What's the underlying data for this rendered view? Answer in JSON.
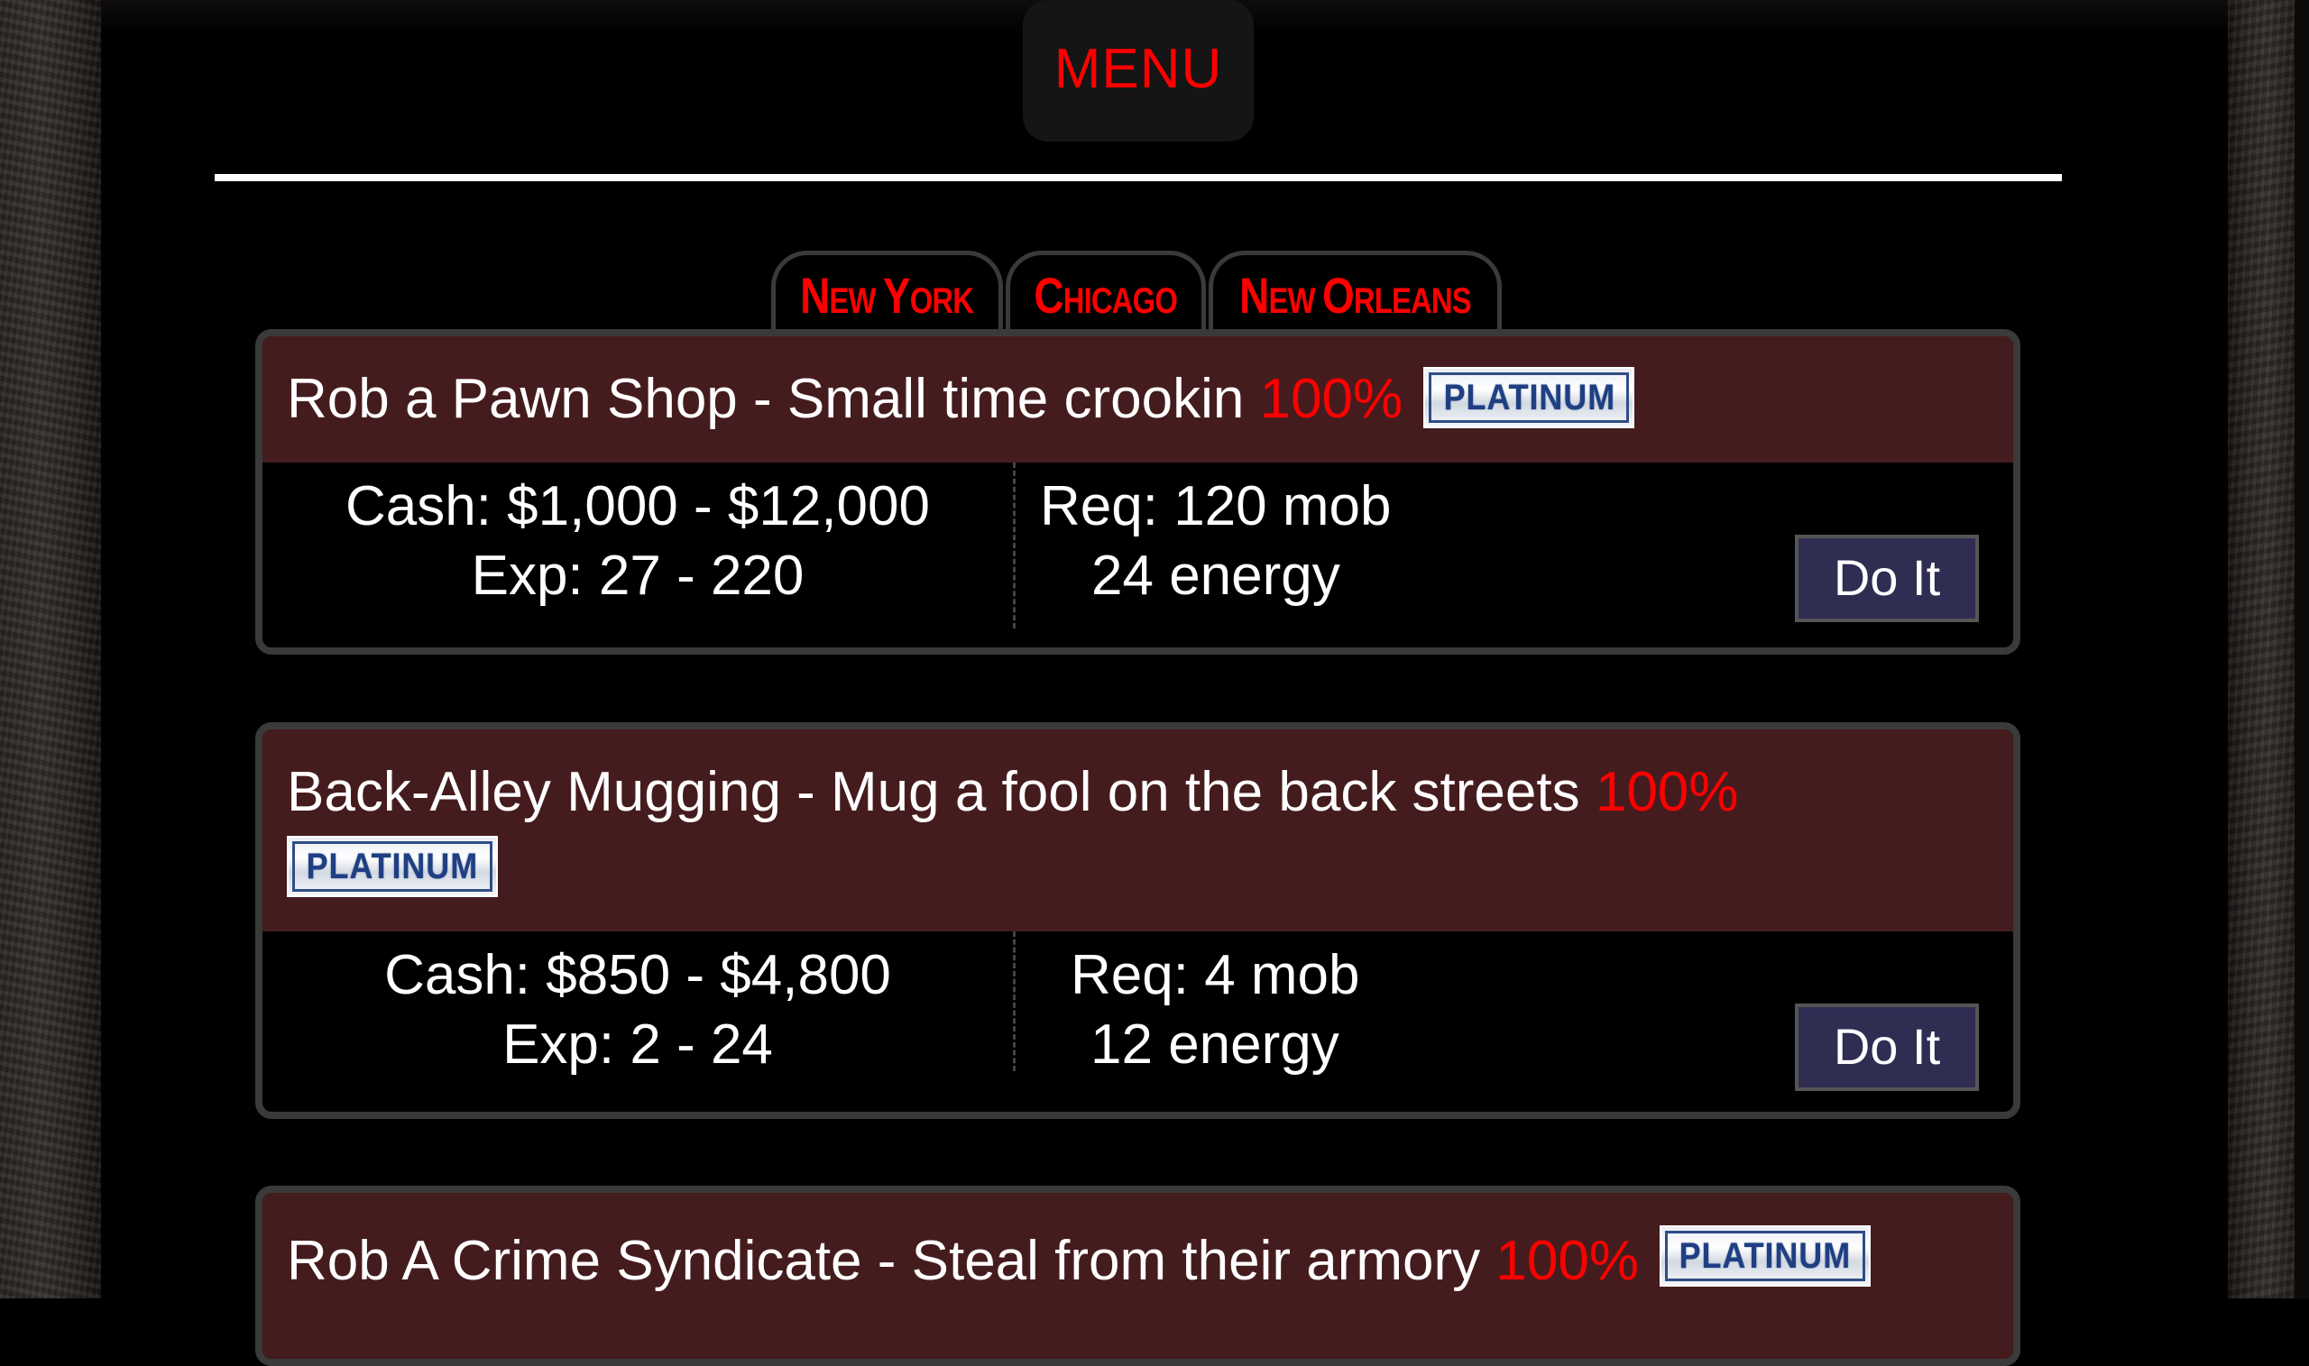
{
  "header": {
    "menu_label": "MENU"
  },
  "tabs": [
    {
      "label_first": "N",
      "label_rest": "ew ",
      "label_first2": "Y",
      "label_rest2": "ork",
      "label": "New York"
    },
    {
      "label_first": "C",
      "label_rest": "hicago",
      "label": "Chicago"
    },
    {
      "label_first": "N",
      "label_rest": "ew ",
      "label_first2": "O",
      "label_rest2": "rleans",
      "label": "New Orleans"
    }
  ],
  "colors": {
    "accent_red": "#ff0000",
    "card_header_bg": "#451c1e",
    "button_bg": "#2f2d52",
    "border_gray": "#3a3a3a"
  },
  "jobs": [
    {
      "title": "Rob a Pawn Shop - Small time crookin",
      "success": "100%",
      "badge": "PLATINUM",
      "cash": "Cash: $1,000 - $12,000",
      "exp": "Exp: 27 - 220",
      "req_mob": "Req: 120 mob",
      "req_energy": "24 energy",
      "button_label": "Do It"
    },
    {
      "title": "Back-Alley Mugging - Mug a fool on the back streets",
      "success": "100%",
      "badge": "PLATINUM",
      "cash": "Cash: $850 - $4,800",
      "exp": "Exp: 2 - 24",
      "req_mob": "Req: 4 mob",
      "req_energy": "12 energy",
      "button_label": "Do It"
    },
    {
      "title": "Rob A Crime Syndicate - Steal from their armory",
      "success": "100%",
      "badge": "PLATINUM"
    }
  ]
}
